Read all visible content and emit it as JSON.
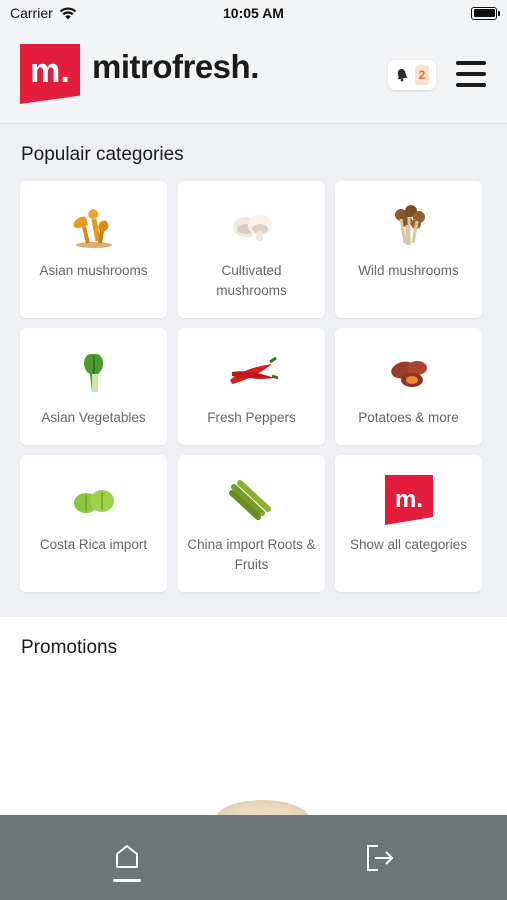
{
  "status_bar": {
    "carrier": "Carrier",
    "time": "10:05 AM"
  },
  "header": {
    "logo_mark": "m.",
    "logo_text": "mitrofresh.",
    "notification_count": "2",
    "brand_color": "#e31e3c"
  },
  "categories": {
    "title": "Populair categories",
    "items": [
      {
        "label": "Asian mushrooms",
        "icon": "asian-mushrooms-icon"
      },
      {
        "label": "Cultivated mushrooms",
        "icon": "cultivated-mushrooms-icon"
      },
      {
        "label": "Wild mushrooms",
        "icon": "wild-mushrooms-icon"
      },
      {
        "label": "Asian Vegetables",
        "icon": "bok-choy-icon"
      },
      {
        "label": "Fresh Peppers",
        "icon": "chili-pepper-icon"
      },
      {
        "label": "Potatoes & more",
        "icon": "sweet-potato-icon"
      },
      {
        "label": "Costa Rica import",
        "icon": "chayote-icon"
      },
      {
        "label": "China import Roots & Fruits",
        "icon": "lemongrass-icon"
      },
      {
        "label": "Show all categories",
        "icon": "mitrofresh-logo-icon"
      }
    ]
  },
  "promotions": {
    "title": "Promotions"
  },
  "bottom_nav": {
    "tabs": [
      {
        "name": "home",
        "icon": "home-icon",
        "active": true
      },
      {
        "name": "logout",
        "icon": "logout-icon",
        "active": false
      }
    ]
  }
}
